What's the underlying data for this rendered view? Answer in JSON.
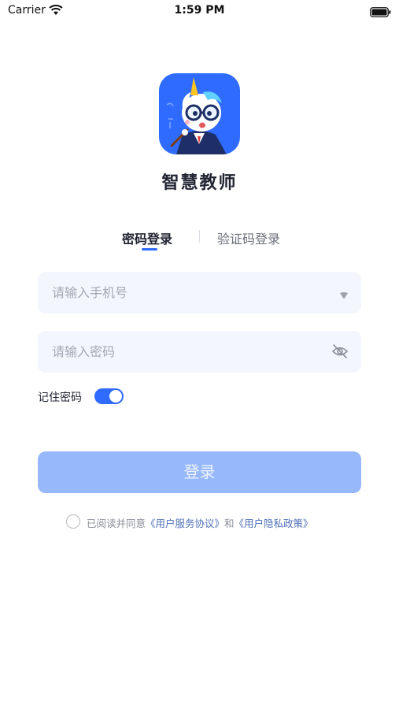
{
  "status_bar": {
    "carrier": "Carrier",
    "time": "1:59 PM"
  },
  "app": {
    "name": "智慧教师",
    "logo_color": "#2f6bff"
  },
  "tabs": [
    {
      "label": "密码登录",
      "active": true
    },
    {
      "label": "验证码登录",
      "active": false
    }
  ],
  "phone_field": {
    "placeholder": "请输入手机号",
    "value": ""
  },
  "password_field": {
    "placeholder": "请输入密码",
    "value": ""
  },
  "remember": {
    "label": "记住密码",
    "enabled": true
  },
  "login_button": {
    "label": "登录"
  },
  "agreement": {
    "prefix": "已阅读并同意",
    "user_agreement": "《用户服务协议》",
    "conjunction": "和",
    "privacy_policy": "《用户隐私政策》",
    "checked": false
  },
  "colors": {
    "accent": "#2f6bff",
    "login_button_disabled": "#97b9fb",
    "link": "#4f6fb8",
    "field_background": "#f3f6fd"
  }
}
